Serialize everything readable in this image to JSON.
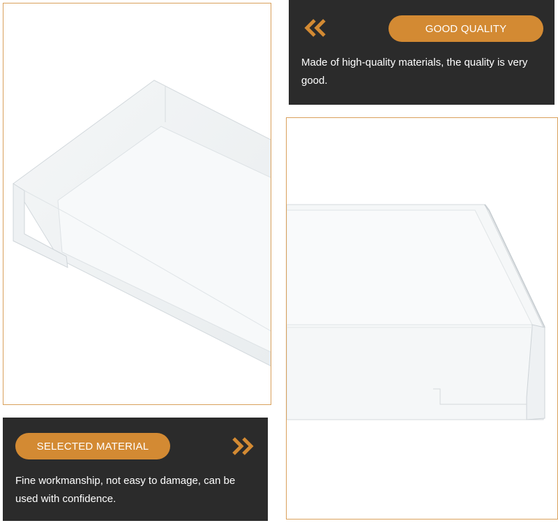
{
  "panel_top": {
    "badge": "GOOD QUALITY",
    "description": "Made of high-quality materials, the quality is very good.",
    "arrow_icon": "double-chevron-left-icon"
  },
  "panel_bottom": {
    "badge": "SELECTED MATERIAL",
    "description": "Fine workmanship, not easy to damage, can be used with confidence.",
    "arrow_icon": "double-chevron-right-icon"
  },
  "colors": {
    "accent": "#d38a33",
    "panel_bg": "#2b2b2b",
    "frame_border": "#d9a05b"
  }
}
